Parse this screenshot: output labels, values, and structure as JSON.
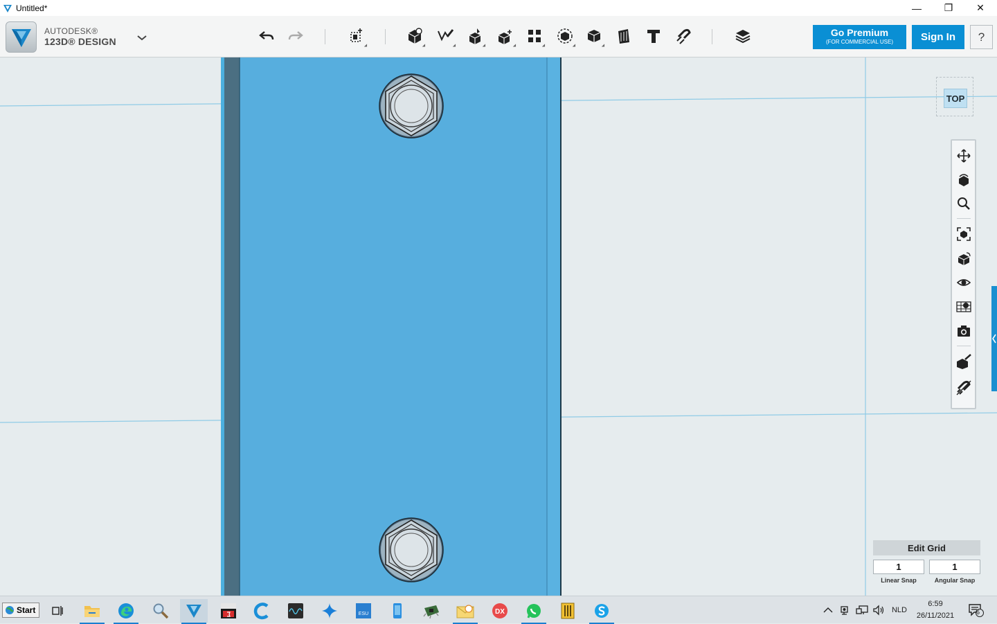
{
  "window": {
    "title": "Untitled*",
    "controls": {
      "minimize": "—",
      "restore": "❐",
      "close": "✕"
    }
  },
  "brand": {
    "line1": "AUTODESK®",
    "line2": "123D® DESIGN"
  },
  "toolbar": {
    "undo": "undo-icon",
    "redo": "redo-icon",
    "tools": [
      "transform",
      "primitives",
      "sketch",
      "construct",
      "modify",
      "pattern",
      "grouping",
      "combine",
      "measure",
      "text",
      "snap",
      "material"
    ]
  },
  "premium": {
    "label": "Go Premium",
    "sub": "(FOR COMMERCIAL USE)"
  },
  "signin": {
    "label": "Sign In"
  },
  "help": {
    "label": "?"
  },
  "viewcube": {
    "face": "TOP"
  },
  "editgrid": {
    "button": "Edit Grid",
    "linear_value": "1",
    "angular_value": "1",
    "linear_label": "Linear Snap",
    "angular_label": "Angular Snap"
  },
  "taskbar": {
    "start": "Start",
    "lang": "NLD",
    "time": "6:59",
    "date": "26/11/2021",
    "notifications": "6"
  },
  "colors": {
    "accent": "#0a8fd4",
    "part_fill": "#57aede",
    "part_side": "#4b6f82",
    "grid_line": "#8fcbe6"
  }
}
